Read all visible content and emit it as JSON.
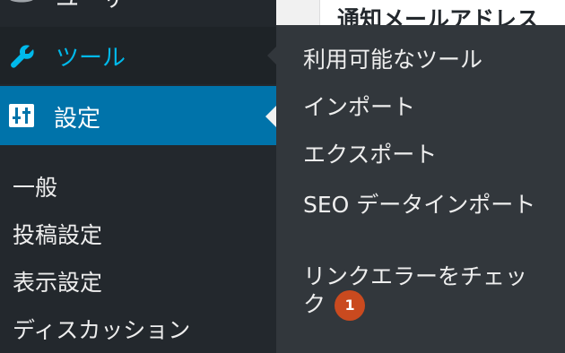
{
  "content": {
    "heading": "通知メールアドレス"
  },
  "menu": {
    "top_user_label": "ユーザー",
    "tools_label": "ツール",
    "settings_label": "設定"
  },
  "settings_submenu": {
    "items": [
      "一般",
      "投稿設定",
      "表示設定",
      "ディスカッション"
    ]
  },
  "tools_flyout": {
    "items": [
      "利用可能なツール",
      "インポート",
      "エクスポート",
      "SEO データインポート",
      "リンクエラーをチェック"
    ],
    "badge_count": "1"
  },
  "colors": {
    "sidebar_bg": "#23282d",
    "flyout_bg": "#32373c",
    "active_bg": "#0073aa",
    "tools_text": "#00b9eb",
    "badge_bg": "#ca4a1f"
  },
  "icons": {
    "tools": "wrench-icon",
    "settings": "settings-sliders-icon",
    "user": "user-icon"
  }
}
